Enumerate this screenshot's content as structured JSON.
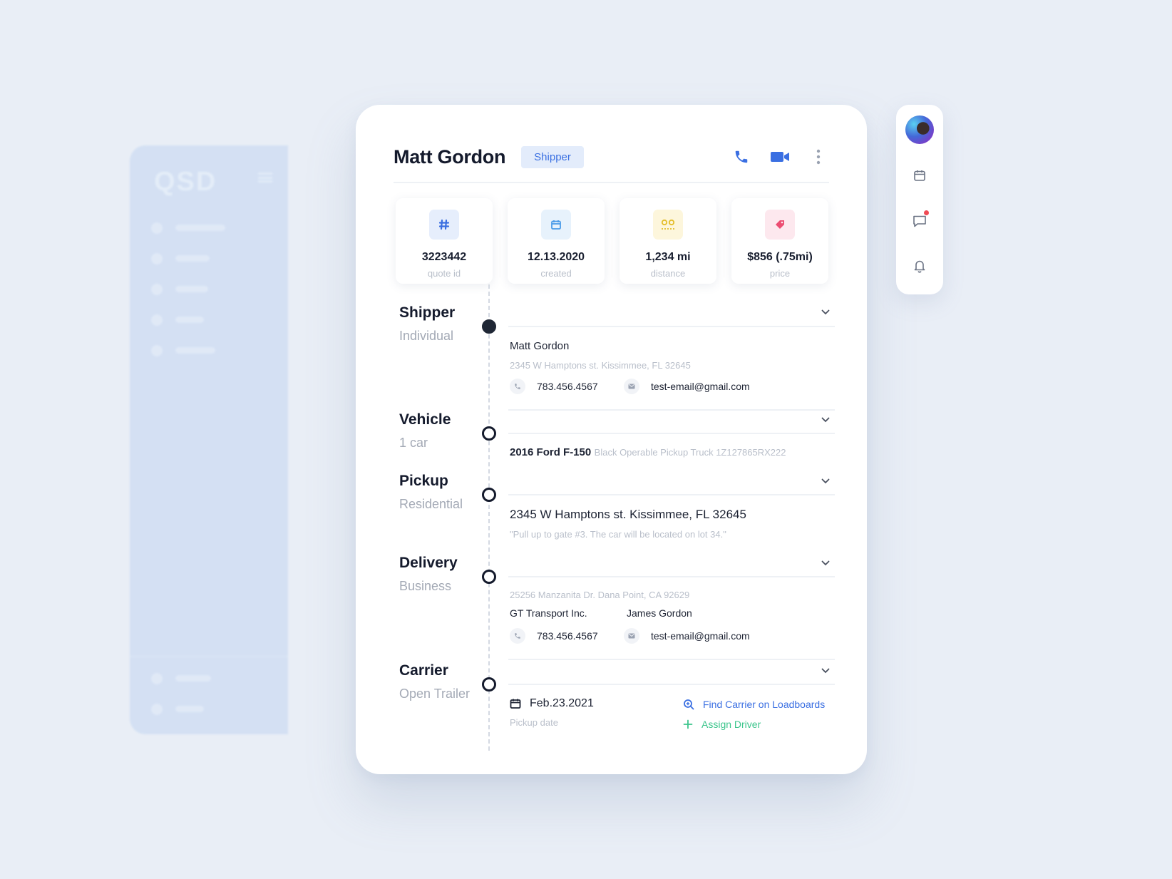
{
  "background_sidebar": {
    "logo": "QSD"
  },
  "contact": {
    "name": "Matt Gordon",
    "role": "Shipper"
  },
  "stats": [
    {
      "value": "3223442",
      "label": "quote id",
      "icon": "hash-icon",
      "icon_bg": "#e6eefc",
      "icon_color": "#3b6fe0"
    },
    {
      "value": "12.13.2020",
      "label": "created",
      "icon": "calendar-icon",
      "icon_bg": "#e7f2fc",
      "icon_color": "#4a9be8"
    },
    {
      "value": "1,234 mi",
      "label": "distance",
      "icon": "route-icon",
      "icon_bg": "#fdf6dc",
      "icon_color": "#e4bd28"
    },
    {
      "value": "$856 (.75mi)",
      "label": "price",
      "icon": "tag-icon",
      "icon_bg": "#fde8ee",
      "icon_color": "#ec4d72"
    }
  ],
  "sections": {
    "shipper": {
      "title": "Shipper",
      "subtitle": "Individual",
      "name": "Matt Gordon",
      "address": "2345 W Hamptons st. Kissimmee, FL 32645",
      "phone": "783.456.4567",
      "email": "test-email@gmail.com"
    },
    "vehicle": {
      "title": "Vehicle",
      "subtitle": "1 car",
      "model": "2016 Ford F-150",
      "details": "Black Operable Pickup Truck 1Z127865RX222"
    },
    "pickup": {
      "title": "Pickup",
      "subtitle": "Residential",
      "address": "2345 W Hamptons st. Kissimmee, FL 32645",
      "note": "\"Pull up to gate #3. The car will be located on lot 34.\""
    },
    "delivery": {
      "title": "Delivery",
      "subtitle": "Business",
      "address": "25256 Manzanita Dr. Dana Point, CA 92629",
      "company": "GT Transport Inc.",
      "contact_name": "James Gordon",
      "phone": "783.456.4567",
      "email": "test-email@gmail.com"
    },
    "carrier": {
      "title": "Carrier",
      "subtitle": "Open Trailer",
      "date": "Feb.23.2021",
      "date_label": "Pickup date",
      "find_link": "Find Carrier on Loadboards",
      "assign_link": "Assign Driver"
    }
  },
  "colors": {
    "accent_blue": "#3a6fe2",
    "accent_green": "#3cc58c",
    "notification": "#f04b55"
  }
}
